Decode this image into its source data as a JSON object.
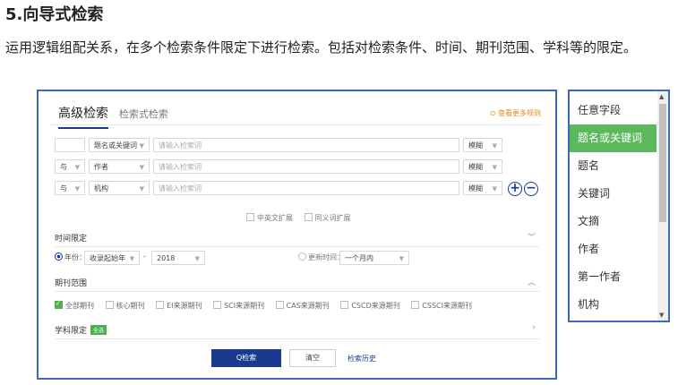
{
  "heading": "5.向导式检索",
  "description": "运用逻辑组配关系，在多个检索条件限定下进行检索。包括对检索条件、时间、期刊范围、学科等的限定。",
  "tabs": {
    "active": "高级检索",
    "other": "检索式检索"
  },
  "more_rules": "⊙ 查看更多规则",
  "rows": [
    {
      "logic": "",
      "field": "题名或关键词",
      "placeholder": "请输入检索词",
      "match": "模糊"
    },
    {
      "logic": "与",
      "field": "作者",
      "placeholder": "请输入检索词",
      "match": "模糊"
    },
    {
      "logic": "与",
      "field": "机构",
      "placeholder": "请输入检索词",
      "match": "模糊"
    }
  ],
  "add_symbol": "+",
  "remove_symbol": "−",
  "expand_options": [
    "中英文扩展",
    "同义词扩展"
  ],
  "time_section": {
    "title": "时间限定",
    "year_label": "年份：",
    "year_start": "收录起始年",
    "dash": "-",
    "year_end": "2018",
    "update_label": "更新时间：",
    "update_value": "一个月内"
  },
  "journal_section": {
    "title": "期刊范围",
    "options": [
      {
        "label": "全部期刊",
        "checked": true
      },
      {
        "label": "核心期刊",
        "checked": false
      },
      {
        "label": "EI来源期刊",
        "checked": false
      },
      {
        "label": "SCI来源期刊",
        "checked": false
      },
      {
        "label": "CAS来源期刊",
        "checked": false
      },
      {
        "label": "CSCD来源期刊",
        "checked": false
      },
      {
        "label": "CSSCI来源期刊",
        "checked": false
      }
    ]
  },
  "subject_section": {
    "title": "学科限定",
    "badge": "全选"
  },
  "buttons": {
    "search": "Q检索",
    "clear": "清空",
    "history": "检索历史"
  },
  "field_dropdown": {
    "items": [
      "任意字段",
      "题名或关键词",
      "题名",
      "关键词",
      "文摘",
      "作者",
      "第一作者",
      "机构"
    ],
    "selected_index": 1
  },
  "colors": {
    "accent": "#1a3a8f",
    "selected": "#5cb85c",
    "border": "#3d6bb8",
    "link": "#e08a1e"
  }
}
